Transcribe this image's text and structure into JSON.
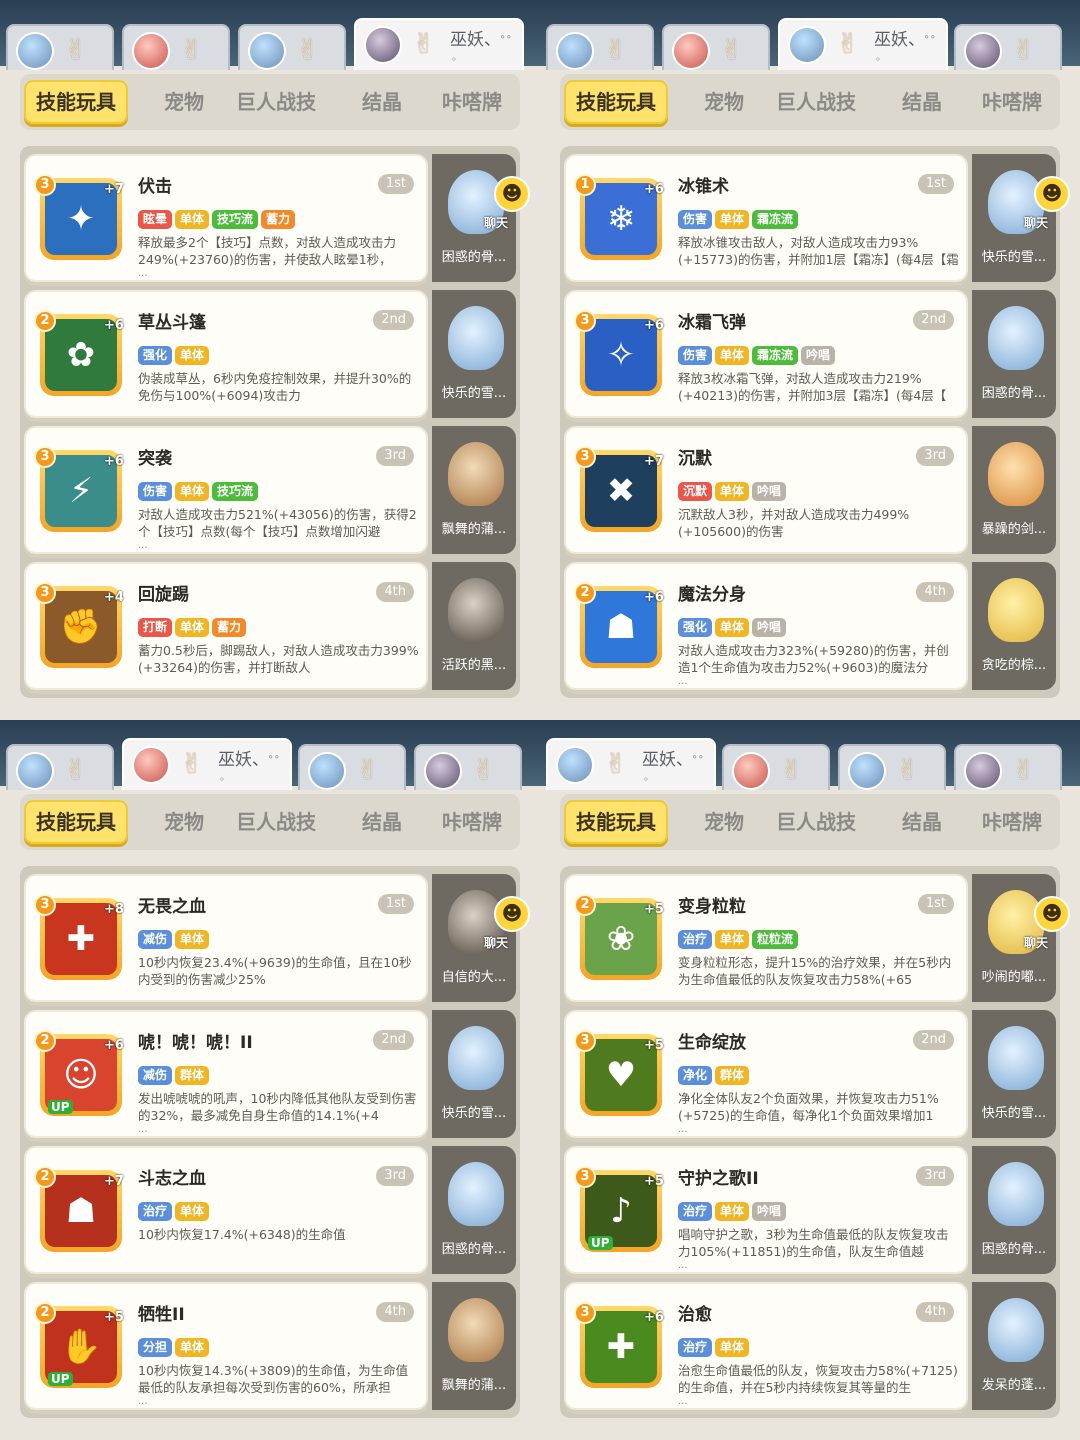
{
  "icons": {
    "hand": "✌",
    "dots": "∘∘",
    "chat": "☻"
  },
  "colors": {
    "tag_red": "#e8574a",
    "tag_yellow": "#efb524",
    "tag_green": "#4dbb3c",
    "tag_orange": "#f08a2a",
    "tag_blue": "#5b8fd9",
    "tag_grey": "#b8b2a7",
    "accent": "#ffe26b",
    "pet_bg": "#6f6a61"
  },
  "panels": [
    {
      "char_tabs": [
        {
          "avatar": "blue",
          "name": "",
          "sub": ""
        },
        {
          "avatar": "red",
          "name": "",
          "sub": ""
        },
        {
          "avatar": "blue",
          "name": "",
          "sub": ""
        },
        {
          "avatar": "dark",
          "name": "巫妖、",
          "sub": "。",
          "active": true
        }
      ],
      "nav": [
        "技能玩具",
        "宠物",
        "巨人战技",
        "结晶",
        "咔嗒牌"
      ],
      "skills": [
        {
          "name": "伏击",
          "order": "1st",
          "level": "3",
          "plus": "+7",
          "up": false,
          "icon_color": "#2d6fbf",
          "icon_symbol": "✦",
          "tags": [
            {
              "text": "眩晕",
              "color": "#e8574a"
            },
            {
              "text": "单体",
              "color": "#efb524"
            },
            {
              "text": "技巧流",
              "color": "#4dbb3c"
            },
            {
              "text": "蓄力",
              "color": "#f08a2a"
            }
          ],
          "desc": "释放最多2个【技巧】点数，对敌人造成攻击力249%(+23760)的伤害，并使敌人眩晕1秒，",
          "more": "...",
          "pet": {
            "name": "困惑的骨...",
            "figure": "blue",
            "chat": true,
            "chat_label": "聊天"
          }
        },
        {
          "name": "草丛斗篷",
          "order": "2nd",
          "level": "2",
          "plus": "+6",
          "up": false,
          "icon_color": "#2f7a3c",
          "icon_symbol": "✿",
          "tags": [
            {
              "text": "强化",
              "color": "#5b8fd9"
            },
            {
              "text": "单体",
              "color": "#efb524"
            }
          ],
          "desc": "伪装成草丛，6秒内免疫控制效果，并提升30%的免伤与100%(+6094)攻击力",
          "more": "",
          "pet": {
            "name": "快乐的雪...",
            "figure": "blue",
            "chat": false,
            "chat_label": ""
          }
        },
        {
          "name": "突袭",
          "order": "3rd",
          "level": "3",
          "plus": "+6",
          "up": false,
          "icon_color": "#3a8d8a",
          "icon_symbol": "⚡",
          "tags": [
            {
              "text": "伤害",
              "color": "#5b8fd9"
            },
            {
              "text": "单体",
              "color": "#efb524"
            },
            {
              "text": "技巧流",
              "color": "#4dbb3c"
            }
          ],
          "desc": "对敌人造成攻击力521%(+43056)的伤害，获得2个【技巧】点数(每个【技巧】点数增加闪避",
          "more": "...",
          "pet": {
            "name": "飘舞的蒲...",
            "figure": "brown",
            "chat": false,
            "chat_label": ""
          }
        },
        {
          "name": "回旋踢",
          "order": "4th",
          "level": "3",
          "plus": "+4",
          "up": false,
          "icon_color": "#8a5a2b",
          "icon_symbol": "✊",
          "tags": [
            {
              "text": "打断",
              "color": "#e8574a"
            },
            {
              "text": "单体",
              "color": "#efb524"
            },
            {
              "text": "蓄力",
              "color": "#f08a2a"
            }
          ],
          "desc": "蓄力0.5秒后，脚踢敌人，对敌人造成攻击力399%(+33264)的伤害，并打断敌人",
          "more": "",
          "pet": {
            "name": "活跃的黑...",
            "figure": "dark",
            "chat": false,
            "chat_label": ""
          }
        }
      ]
    },
    {
      "char_tabs": [
        {
          "avatar": "blue",
          "name": "",
          "sub": ""
        },
        {
          "avatar": "red",
          "name": "",
          "sub": ""
        },
        {
          "avatar": "blue",
          "name": "巫妖、",
          "sub": "。",
          "active": true
        },
        {
          "avatar": "dark",
          "name": "",
          "sub": ""
        }
      ],
      "nav": [
        "技能玩具",
        "宠物",
        "巨人战技",
        "结晶",
        "咔嗒牌"
      ],
      "skills": [
        {
          "name": "冰锥术",
          "order": "1st",
          "level": "1",
          "plus": "+6",
          "up": false,
          "icon_color": "#3b6fd6",
          "icon_symbol": "❄",
          "tags": [
            {
              "text": "伤害",
              "color": "#5b8fd9"
            },
            {
              "text": "单体",
              "color": "#efb524"
            },
            {
              "text": "霜冻流",
              "color": "#4dbb3c"
            }
          ],
          "desc": "释放冰锥攻击敌人，对敌人造成攻击力93%(+15773)的伤害，并附加1层【霜冻】(每4层【霜",
          "more": "",
          "pet": {
            "name": "快乐的雪...",
            "figure": "blue",
            "chat": true,
            "chat_label": "聊天"
          }
        },
        {
          "name": "冰霜飞弹",
          "order": "2nd",
          "level": "3",
          "plus": "+6",
          "up": false,
          "icon_color": "#2a5fc4",
          "icon_symbol": "✧",
          "tags": [
            {
              "text": "伤害",
              "color": "#5b8fd9"
            },
            {
              "text": "单体",
              "color": "#efb524"
            },
            {
              "text": "霜冻流",
              "color": "#4dbb3c"
            },
            {
              "text": "吟唱",
              "color": "#b8b2a7"
            }
          ],
          "desc": "释放3枚冰霜飞弹，对敌人造成攻击力219%(+40213)的伤害，并附加3层【霜冻】(每4层【",
          "more": "",
          "pet": {
            "name": "困惑的骨...",
            "figure": "blue",
            "chat": false,
            "chat_label": ""
          }
        },
        {
          "name": "沉默",
          "order": "3rd",
          "level": "3",
          "plus": "+7",
          "up": false,
          "icon_color": "#1f3f5e",
          "icon_symbol": "✖",
          "tags": [
            {
              "text": "沉默",
              "color": "#e8574a"
            },
            {
              "text": "单体",
              "color": "#efb524"
            },
            {
              "text": "吟唱",
              "color": "#b8b2a7"
            }
          ],
          "desc": "沉默敌人3秒，并对敌人造成攻击力499%(+105600)的伤害",
          "more": "",
          "pet": {
            "name": "暴躁的剑...",
            "figure": "orange",
            "chat": false,
            "chat_label": ""
          }
        },
        {
          "name": "魔法分身",
          "order": "4th",
          "level": "2",
          "plus": "+6",
          "up": false,
          "icon_color": "#2f77d8",
          "icon_symbol": "☗",
          "tags": [
            {
              "text": "强化",
              "color": "#5b8fd9"
            },
            {
              "text": "单体",
              "color": "#efb524"
            },
            {
              "text": "吟唱",
              "color": "#b8b2a7"
            }
          ],
          "desc": "对敌人造成攻击力323%(+59280)的伤害，并创造1个生命值为攻击力52%(+9603)的魔法分",
          "more": "...",
          "pet": {
            "name": "贪吃的棕...",
            "figure": "yellow",
            "chat": false,
            "chat_label": ""
          }
        }
      ]
    },
    {
      "char_tabs": [
        {
          "avatar": "blue",
          "name": "",
          "sub": ""
        },
        {
          "avatar": "red",
          "name": "巫妖、",
          "sub": "。",
          "active": true
        },
        {
          "avatar": "blue",
          "name": "",
          "sub": ""
        },
        {
          "avatar": "dark",
          "name": "",
          "sub": ""
        }
      ],
      "nav": [
        "技能玩具",
        "宠物",
        "巨人战技",
        "结晶",
        "咔嗒牌"
      ],
      "skills": [
        {
          "name": "无畏之血",
          "order": "1st",
          "level": "3",
          "plus": "+8",
          "up": false,
          "icon_color": "#c8361f",
          "icon_symbol": "✚",
          "tags": [
            {
              "text": "减伤",
              "color": "#5b8fd9"
            },
            {
              "text": "单体",
              "color": "#efb524"
            }
          ],
          "desc": "10秒内恢复23.4%(+9639)的生命值，且在10秒内受到的伤害减少25%",
          "more": "",
          "pet": {
            "name": "自信的大...",
            "figure": "dark",
            "chat": true,
            "chat_label": "聊天"
          }
        },
        {
          "name": "唬！唬！唬！II",
          "order": "2nd",
          "level": "2",
          "plus": "+6",
          "up": true,
          "icon_color": "#d8442d",
          "icon_symbol": "☺",
          "tags": [
            {
              "text": "减伤",
              "color": "#5b8fd9"
            },
            {
              "text": "群体",
              "color": "#efb524"
            }
          ],
          "desc": "发出唬唬唬的吼声，10秒内降低其他队友受到伤害的32%，最多减免自身生命值的14.1%(+4",
          "more": "...",
          "pet": {
            "name": "快乐的雪...",
            "figure": "blue",
            "chat": false,
            "chat_label": ""
          }
        },
        {
          "name": "斗志之血",
          "order": "3rd",
          "level": "2",
          "plus": "+7",
          "up": false,
          "icon_color": "#b5301d",
          "icon_symbol": "☗",
          "tags": [
            {
              "text": "治疗",
              "color": "#5b8fd9"
            },
            {
              "text": "单体",
              "color": "#efb524"
            }
          ],
          "desc": "10秒内恢复17.4%(+6348)的生命值",
          "more": "",
          "pet": {
            "name": "困惑的骨...",
            "figure": "blue",
            "chat": false,
            "chat_label": ""
          }
        },
        {
          "name": "牺牲II",
          "order": "4th",
          "level": "2",
          "plus": "+5",
          "up": true,
          "icon_color": "#c0311e",
          "icon_symbol": "✋",
          "tags": [
            {
              "text": "分担",
              "color": "#5b8fd9"
            },
            {
              "text": "单体",
              "color": "#efb524"
            }
          ],
          "desc": "10秒内恢复14.3%(+3809)的生命值，为生命值最低的队友承担每次受到伤害的60%，所承担",
          "more": "...",
          "pet": {
            "name": "飘舞的蒲...",
            "figure": "brown",
            "chat": false,
            "chat_label": ""
          }
        }
      ]
    },
    {
      "char_tabs": [
        {
          "avatar": "blue",
          "name": "巫妖、",
          "sub": "。",
          "active": true
        },
        {
          "avatar": "red",
          "name": "",
          "sub": ""
        },
        {
          "avatar": "blue",
          "name": "",
          "sub": ""
        },
        {
          "avatar": "dark",
          "name": "",
          "sub": ""
        }
      ],
      "nav": [
        "技能玩具",
        "宠物",
        "巨人战技",
        "结晶",
        "咔嗒牌"
      ],
      "skills": [
        {
          "name": "变身粒粒",
          "order": "1st",
          "level": "2",
          "plus": "+5",
          "up": false,
          "icon_color": "#6aa34a",
          "icon_symbol": "❀",
          "tags": [
            {
              "text": "治疗",
              "color": "#5b8fd9"
            },
            {
              "text": "单体",
              "color": "#efb524"
            },
            {
              "text": "粒粒流",
              "color": "#4dbb3c"
            }
          ],
          "desc": "变身粒粒形态，提升15%的治疗效果，并在5秒内为生命值最低的队友恢复攻击力58%(+65",
          "more": "",
          "pet": {
            "name": "吵闹的嘟...",
            "figure": "yellow",
            "chat": true,
            "chat_label": "聊天"
          }
        },
        {
          "name": "生命绽放",
          "order": "2nd",
          "level": "3",
          "plus": "+5",
          "up": false,
          "icon_color": "#4f7a1d",
          "icon_symbol": "♥",
          "tags": [
            {
              "text": "净化",
              "color": "#5b8fd9"
            },
            {
              "text": "群体",
              "color": "#efb524"
            }
          ],
          "desc": "净化全体队友2个负面效果，并恢复攻击力51%(+5725)的生命值，每净化1个负面效果增加1",
          "more": "...",
          "pet": {
            "name": "快乐的雪...",
            "figure": "blue",
            "chat": false,
            "chat_label": ""
          }
        },
        {
          "name": "守护之歌II",
          "order": "3rd",
          "level": "3",
          "plus": "+5",
          "up": true,
          "icon_color": "#3e5a1a",
          "icon_symbol": "♪",
          "tags": [
            {
              "text": "治疗",
              "color": "#5b8fd9"
            },
            {
              "text": "单体",
              "color": "#efb524"
            },
            {
              "text": "吟唱",
              "color": "#b8b2a7"
            }
          ],
          "desc": "唱响守护之歌，3秒为生命值最低的队友恢复攻击力105%(+11851)的生命值，队友生命值越",
          "more": "...",
          "pet": {
            "name": "困惑的骨...",
            "figure": "blue",
            "chat": false,
            "chat_label": ""
          }
        },
        {
          "name": "治愈",
          "order": "4th",
          "level": "3",
          "plus": "+6",
          "up": false,
          "icon_color": "#4a8a1f",
          "icon_symbol": "✚",
          "tags": [
            {
              "text": "治疗",
              "color": "#5b8fd9"
            },
            {
              "text": "单体",
              "color": "#efb524"
            }
          ],
          "desc": "治愈生命值最低的队友，恢复攻击力58%(+7125)的生命值，并在5秒内持续恢复其等量的生",
          "more": "...",
          "pet": {
            "name": "发呆的蓬...",
            "figure": "blue",
            "chat": false,
            "chat_label": ""
          }
        }
      ]
    }
  ]
}
